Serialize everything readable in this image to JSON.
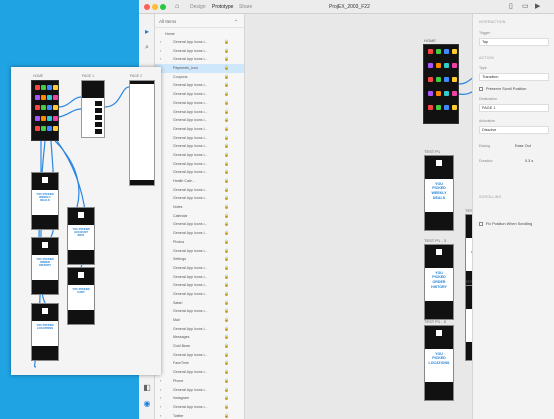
{
  "window": {
    "title": "ProjEX_2003_F22",
    "tabs": [
      "Design",
      "Prototype",
      "Share"
    ],
    "active_tab": "Prototype",
    "traffic_colors": [
      "#ff5f57",
      "#febc2e",
      "#28c840"
    ]
  },
  "layers_panel": {
    "header": "All Items",
    "group": "Home",
    "items": [
      "General App Icons i...",
      "General App Icons i...",
      "General App Icons i...",
      "Payments_Icon",
      "Coupons",
      "General App Icons i...",
      "General App Icons i...",
      "General App Icons i...",
      "General App Icons i...",
      "General App Icons i...",
      "General App Icons i...",
      "General App Icons i...",
      "General App Icons i...",
      "General App Icons i...",
      "General App Icons i...",
      "General App Icons i...",
      "Health Cale...",
      "General App Icons i...",
      "General App Icons i...",
      "Notes",
      "Calendar",
      "General App Icons i...",
      "General App Icons i...",
      "Photos",
      "General App Icons i...",
      "Settings",
      "General App Icons i...",
      "General App Icons i...",
      "General App Icons i...",
      "General App Icons i...",
      "Safari",
      "General App Icons i...",
      "Mail",
      "General App Icons i...",
      "Messages",
      "Gold Bean",
      "General App Icons i...",
      "FaceTime",
      "General App Icons i...",
      "Phone",
      "General App Icons i...",
      "Instagram",
      "General App Icons i...",
      "Twitter",
      "General App Icons i..."
    ]
  },
  "canvas": {
    "artboards": {
      "home": "HOME",
      "page1": "PAGE 1",
      "page2": "PAGE 2",
      "test1": "TEST P1",
      "test2": "TEST P1 - 2",
      "test3": "TEST P1 - 3",
      "test4": "TEST P1 - 4",
      "test5": "TEST P1 - 5"
    },
    "cards": [
      "YOU PICKED WEEKLY DEALS",
      "YOU PICKED ACCOUNT INFO",
      "YOU PICKED ORDER HISTORY",
      "YOU PICKED CART",
      "YOU PICKED LOCATIONS"
    ]
  },
  "properties": {
    "interaction_label": "INTERACTION",
    "trigger_label": "Trigger",
    "trigger_value": "Tap",
    "action_label": "ACTION",
    "type_label": "Type",
    "type_value": "Transition",
    "preserve_scroll": "Preserve Scroll Position",
    "destination_label": "Destination",
    "destination_value": "PAGE 1",
    "animation_label": "Animation",
    "animation_value": "Dissolve",
    "easing_label": "Easing",
    "easing_value": "Ease Out",
    "duration_label": "Duration",
    "duration_value": "0.3 s",
    "scrolling_label": "SCROLLING",
    "fix_position": "Fix Position When Scrolling"
  },
  "colors": {
    "desktop": "#1fa3e3",
    "wire": "#2b86e0",
    "selected_layer": "#cfe7fb",
    "card_text": "#1c7fd6"
  }
}
